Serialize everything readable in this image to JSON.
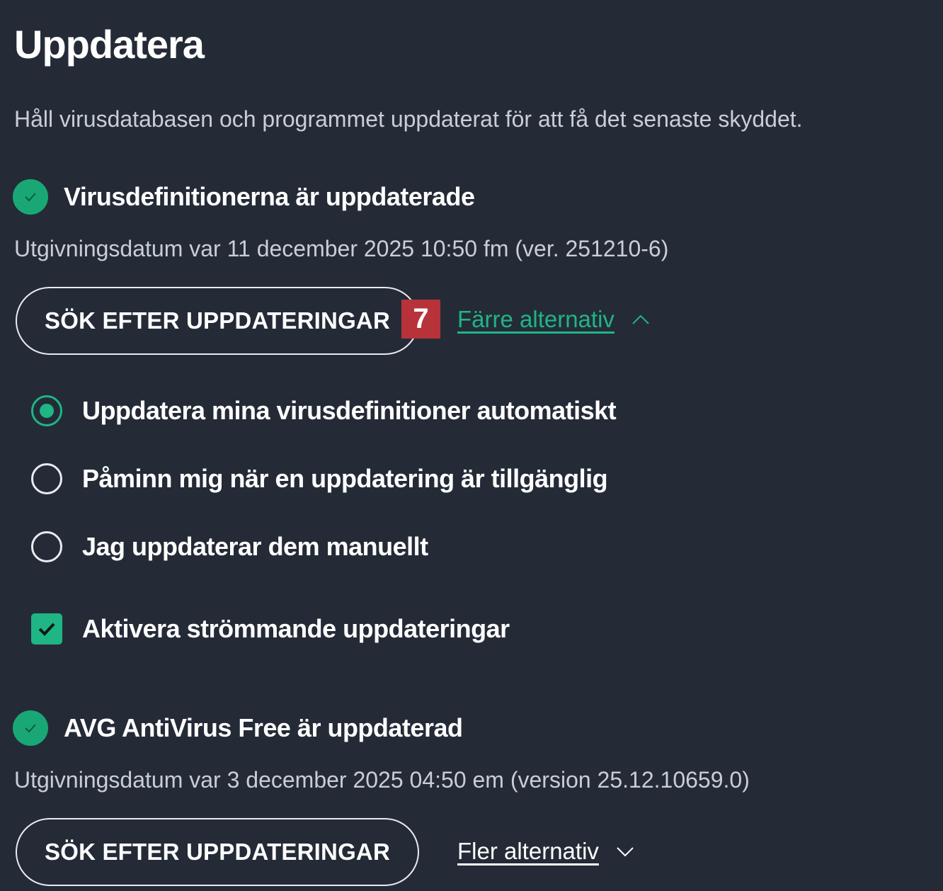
{
  "page": {
    "title": "Uppdatera",
    "description": "Håll virusdatabasen och programmet uppdaterat för att få det senaste skyddet."
  },
  "virus_definitions": {
    "status": "Virusdefinitionerna är uppdaterade",
    "release_info": "Utgivningsdatum var 11 december 2025 10:50 fm (ver. 251210-6)",
    "check_button": "SÖK EFTER UPPDATERINGAR",
    "badge": "7",
    "options_link": "Färre alternativ",
    "options": [
      {
        "label": "Uppdatera mina virusdefinitioner automatiskt",
        "selected": true
      },
      {
        "label": "Påminn mig när en uppdatering är tillgänglig",
        "selected": false
      },
      {
        "label": "Jag uppdaterar dem manuellt",
        "selected": false
      }
    ],
    "streaming_updates": {
      "label": "Aktivera strömmande uppdateringar",
      "checked": true
    }
  },
  "program": {
    "status": "AVG AntiVirus Free är uppdaterad",
    "release_info": "Utgivningsdatum var 3 december 2025 04:50 em (version 25.12.10659.0)",
    "check_button": "SÖK EFTER UPPDATERINGAR",
    "options_link": "Fler alternativ"
  },
  "icons": {
    "status_ok": "check-circle-icon",
    "collapse": "chevron-up-icon",
    "expand": "chevron-down-icon"
  },
  "colors": {
    "background": "#242b37",
    "accent_green": "#1fb584",
    "badge_red": "#b8323a"
  }
}
